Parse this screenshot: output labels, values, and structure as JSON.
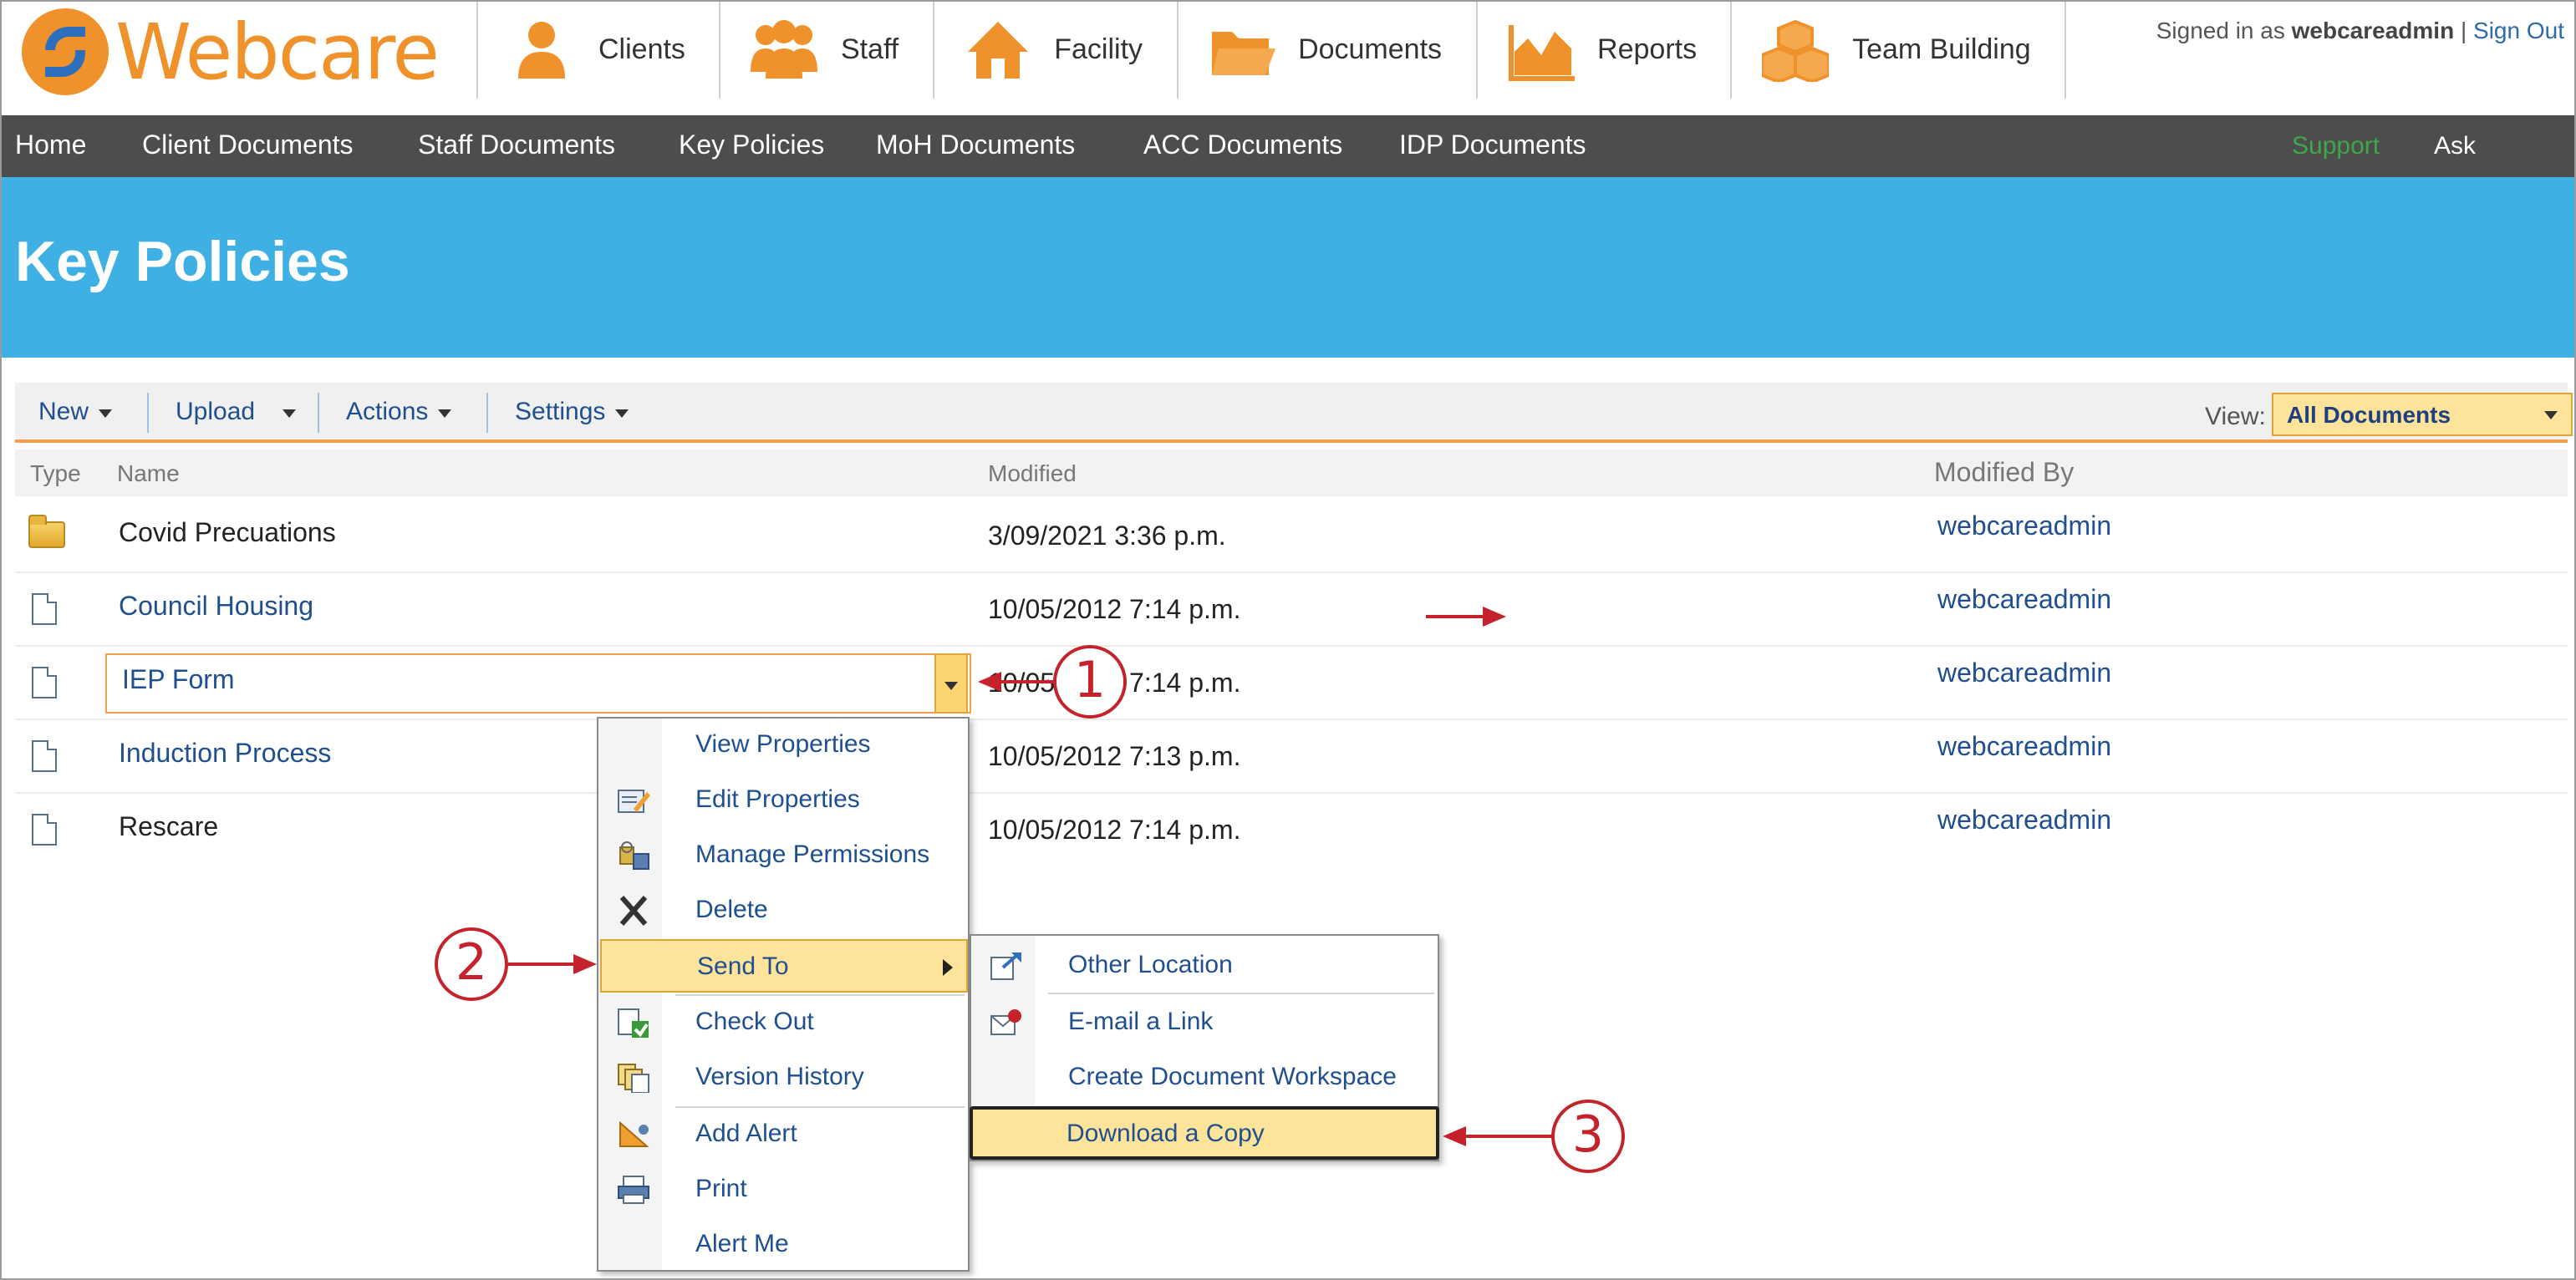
{
  "brand": {
    "name": "Webcare"
  },
  "main_nav": [
    {
      "label": "Clients",
      "icon": "person-icon"
    },
    {
      "label": "Staff",
      "icon": "group-icon"
    },
    {
      "label": "Facility",
      "icon": "house-icon"
    },
    {
      "label": "Documents",
      "icon": "folder-icon"
    },
    {
      "label": "Reports",
      "icon": "chart-icon"
    },
    {
      "label": "Team Building",
      "icon": "boxes-icon"
    }
  ],
  "user": {
    "prefix": "Signed in as ",
    "name": "webcareadmin",
    "divider": " | ",
    "signout": "Sign Out"
  },
  "sub_nav": {
    "items": [
      "Home",
      "Client Documents",
      "Staff Documents",
      "Key Policies",
      "MoH Documents",
      "ACC Documents",
      "IDP Documents"
    ],
    "support": "Support",
    "ask": "Ask Question"
  },
  "page_title": "Key Policies",
  "toolbar": {
    "new": "New",
    "upload": "Upload",
    "actions": "Actions",
    "settings": "Settings",
    "view_label": "View:",
    "view_value": "All Documents"
  },
  "columns": {
    "type": "Type",
    "name": "Name",
    "modified": "Modified",
    "modified_by": "Modified By"
  },
  "rows": [
    {
      "name": "Covid Precuations",
      "modified": "3/09/2021 3:36 p.m.",
      "modified_by": "webcareadmin",
      "type": "folder"
    },
    {
      "name": "Council Housing",
      "modified": "10/05/2012 7:14 p.m.",
      "modified_by": "webcareadmin",
      "type": "document"
    },
    {
      "name": "IEP Form",
      "modified": "10/05/2012 7:14 p.m.",
      "modified_by": "webcareadmin",
      "type": "document"
    },
    {
      "name": "Induction Process",
      "modified": "10/05/2012 7:13 p.m.",
      "modified_by": "webcareadmin",
      "type": "document"
    },
    {
      "name": "Rescare",
      "modified": "10/05/2012 7:14 p.m.",
      "modified_by": "webcareadmin",
      "type": "document"
    }
  ],
  "context_menu": {
    "items": [
      {
        "label": "View Properties",
        "icon": ""
      },
      {
        "label": "Edit Properties",
        "icon": "edit-properties-icon"
      },
      {
        "label": "Manage Permissions",
        "icon": "permissions-icon"
      },
      {
        "label": "Delete",
        "icon": "delete-icon"
      },
      {
        "label": "Send To",
        "icon": "",
        "highlighted": true
      },
      {
        "label": "Check Out",
        "icon": "check-out-icon"
      },
      {
        "label": "Version History",
        "icon": "version-history-icon"
      },
      {
        "label": "Add Alert",
        "icon": "alert-icon"
      },
      {
        "label": "Print",
        "icon": "print-icon"
      },
      {
        "label": "Alert Me",
        "icon": ""
      }
    ]
  },
  "send_to_menu": {
    "items": [
      {
        "label": "Other Location",
        "icon": "send-location-icon"
      },
      {
        "label": "E-mail a Link",
        "icon": "email-link-icon"
      },
      {
        "label": "Create Document Workspace",
        "icon": ""
      },
      {
        "label": "Download a Copy",
        "icon": "",
        "highlighted": true
      }
    ]
  },
  "callouts": [
    "1",
    "2",
    "3"
  ],
  "colors": {
    "accent": "#3fb0e3",
    "brand_orange": "#f0922b",
    "nav_dark": "#4d4d4d",
    "highlight": "#fde49a",
    "annotation": "#c4232b",
    "link": "#1f4f8f"
  }
}
